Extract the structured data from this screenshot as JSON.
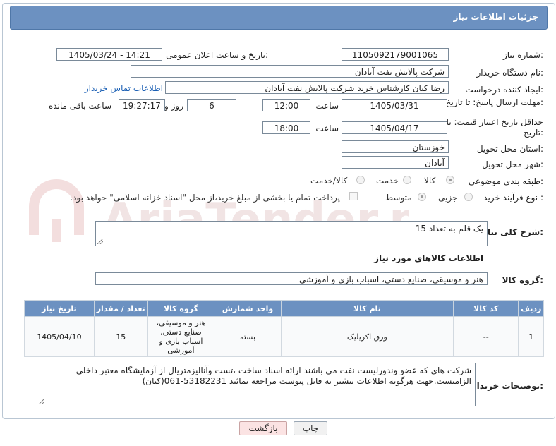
{
  "title": "جزئیات اطلاعات نیاز",
  "need_number": {
    "label": "شماره نیاز:",
    "value": "1105092179001065"
  },
  "announce_datetime": {
    "label": "تاریخ و ساعت اعلان عمومی:",
    "value": "1405/03/24 - 14:21"
  },
  "buyer_org": {
    "label": "نام دستگاه خریدار:",
    "value": "شرکت پالایش نفت آبادان"
  },
  "requester": {
    "label": "ایجاد کننده درخواست:",
    "value": "رضا کیان کارشناس خرید  شرکت پالایش نفت آبادان",
    "contact_link": "اطلاعات تماس خریدار"
  },
  "reply_deadline": {
    "label": "مهلت ارسال پاسخ: تا تاریخ:",
    "date": "1405/03/31",
    "time_label": "ساعت",
    "time": "12:00",
    "days": "6",
    "days_label": "روز و",
    "remaining": "19:27:17",
    "remaining_label": "ساعت باقی مانده"
  },
  "price_validity": {
    "label": "حداقل تاریخ اعتبار قیمت: تا تاریخ:",
    "date": "1405/04/17",
    "time_label": "ساعت",
    "time": "18:00"
  },
  "delivery_province": {
    "label": "استان محل تحویل:",
    "value": "خوزستان"
  },
  "delivery_city": {
    "label": "شهر محل تحویل:",
    "value": "آبادان"
  },
  "category": {
    "label": "طبقه بندی موضوعی:",
    "options": [
      "کالا",
      "خدمت",
      "کالا/خدمت"
    ],
    "selected": "کالا"
  },
  "purchase_process": {
    "label": "نوع فرآیند خرید :",
    "options": [
      "جزیی",
      "متوسط"
    ],
    "selected": "متوسط",
    "payment_note": "پرداخت تمام یا بخشی از مبلغ خرید،از محل \"اسناد خزانه اسلامی\" خواهد بود."
  },
  "overall_description": {
    "label": "شرح کلی نیاز:",
    "value": "یک قلم به تعداد 15"
  },
  "goods_info_heading": "اطلاعات کالاهای مورد نیاز",
  "goods_group": {
    "label": "گروه کالا:",
    "value": "هنر و موسیقی، صنایع دستی، اسباب بازی و آموزشی"
  },
  "table": {
    "headers": [
      "ردیف",
      "کد کالا",
      "نام کالا",
      "واحد شمارش",
      "گروه کالا",
      "تعداد / مقدار",
      "تاریخ نیاز"
    ],
    "rows": [
      [
        "1",
        "--",
        "ورق اکریلیک",
        "بسته",
        "هنر و موسیقی، صنایع دستی، اسباب بازی و آموزشی",
        "15",
        "1405/04/10"
      ]
    ]
  },
  "buyer_notes": {
    "label": "توضیحات خریدار:",
    "value": "شرکت های که عضو وندورلیست نفت می باشند  ارائه اسناد ساخت ،تست وآنالیزمتریال از آزمایشگاه معتبر داخلی الزامیست.جهت هرگونه اطلاعات بیشتر به فایل پیوست مراجعه نمائید 53182231-061(کیان)"
  },
  "buttons": {
    "print": "چاپ",
    "back": "بازگشت"
  },
  "colors": {
    "header_blue": "#6c91c1",
    "link_blue": "#1a5fb4",
    "back_button_bg": "#fbe3e3"
  }
}
